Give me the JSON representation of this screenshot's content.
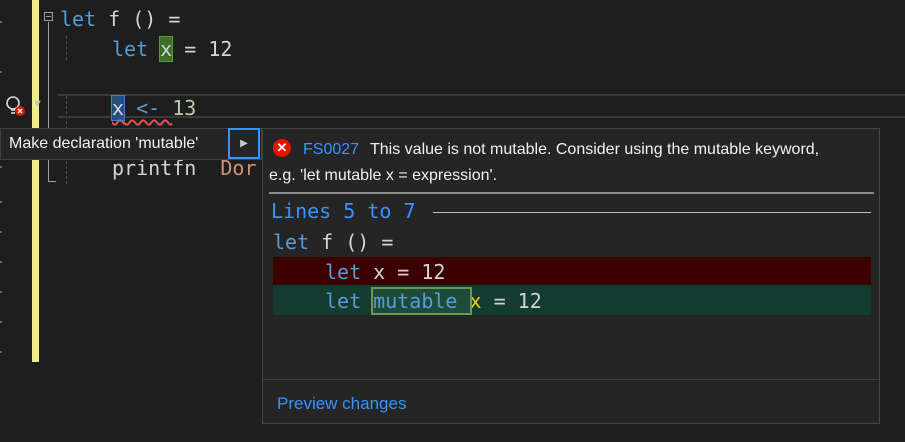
{
  "editor": {
    "line1": {
      "kw": "let",
      "rest": " f () ="
    },
    "line2": {
      "kw": "let",
      "var": "x",
      "rest": " = 12"
    },
    "line3": {
      "var": "x",
      "op": " <- ",
      "num": "13"
    },
    "line4": {
      "text": "printfn",
      "tail": "Dor"
    }
  },
  "quick_action": {
    "label": "Make declaration 'mutable'",
    "arrow": "▶"
  },
  "preview": {
    "error_code": "FS0027",
    "message_line1": "This value is not mutable. Consider using the mutable keyword,",
    "message_line2": "e.g. 'let mutable x = expression'.",
    "lines_title": "Lines 5 to 7",
    "code_line1": {
      "kw": "let",
      "rest": " f () ="
    },
    "removed_line": {
      "kw": "let",
      "rest": " x = 12"
    },
    "added_line": {
      "kw": "let",
      "mutable": "mutable ",
      "var": "x",
      "rest": " = 12"
    },
    "preview_link": "Preview changes"
  },
  "icons": {
    "lightbulb": "lightbulb-error-icon",
    "error": "error-circle-icon",
    "expand": "chevron-right-icon",
    "fold": "collapse-icon"
  },
  "colors": {
    "keyword": "#569cd6",
    "link": "#3794ff",
    "change_bar": "#f0ee8c",
    "removed_bg": "#3b0000",
    "added_bg": "#143b30"
  }
}
